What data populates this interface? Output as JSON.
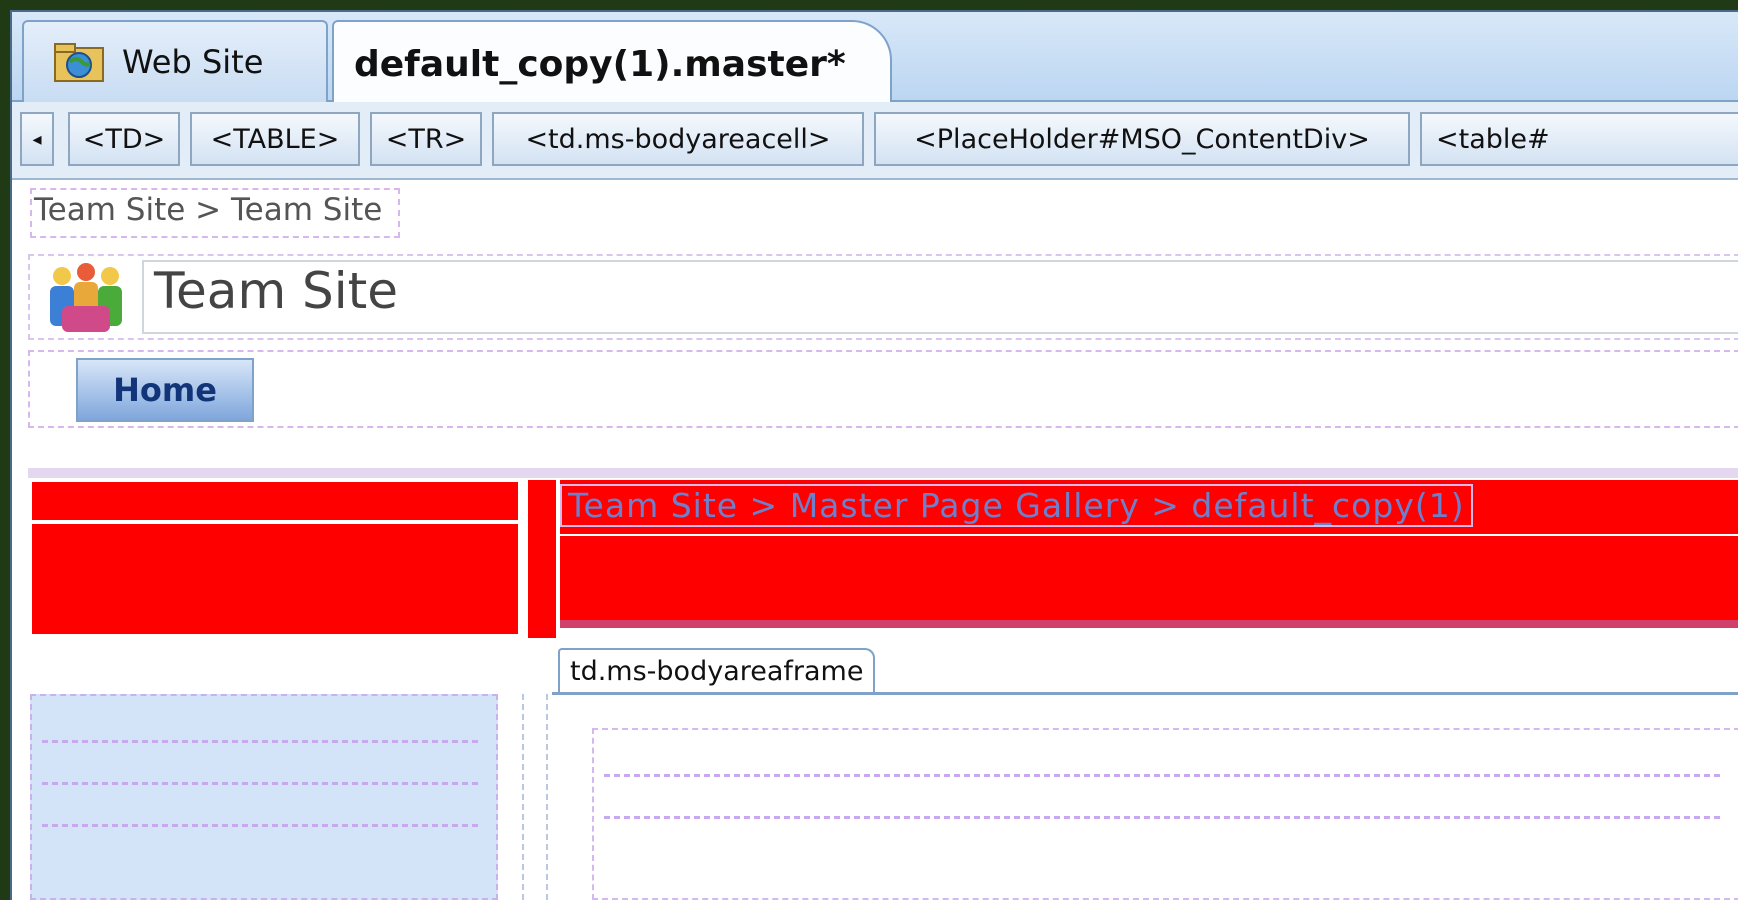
{
  "tabs": [
    {
      "label": "Web Site",
      "icon": "website-icon",
      "active": false
    },
    {
      "label": "default_copy(1).master*",
      "active": true
    }
  ],
  "tag_path": {
    "scroll_left": "◂",
    "items": [
      "<TD>",
      "<TABLE>",
      "<TR>",
      "<td.ms-bodyareacell>",
      "<PlaceHolder#MSO_ContentDiv>",
      "<table#"
    ]
  },
  "page": {
    "breadcrumb_top": "Team Site > Team Site",
    "site_title": "Team Site",
    "nav_home": "Home",
    "breadcrumb_body": "Team Site > Master Page Gallery > default_copy(1)",
    "bodyarea_frame_label": "td.ms-bodyareaframe"
  },
  "colors": {
    "highlight_red": "#ff0000",
    "tab_border": "#7fa2c8",
    "selection_dotted": "#d7b8ec",
    "left_pane_bg": "#d4e4f8"
  }
}
